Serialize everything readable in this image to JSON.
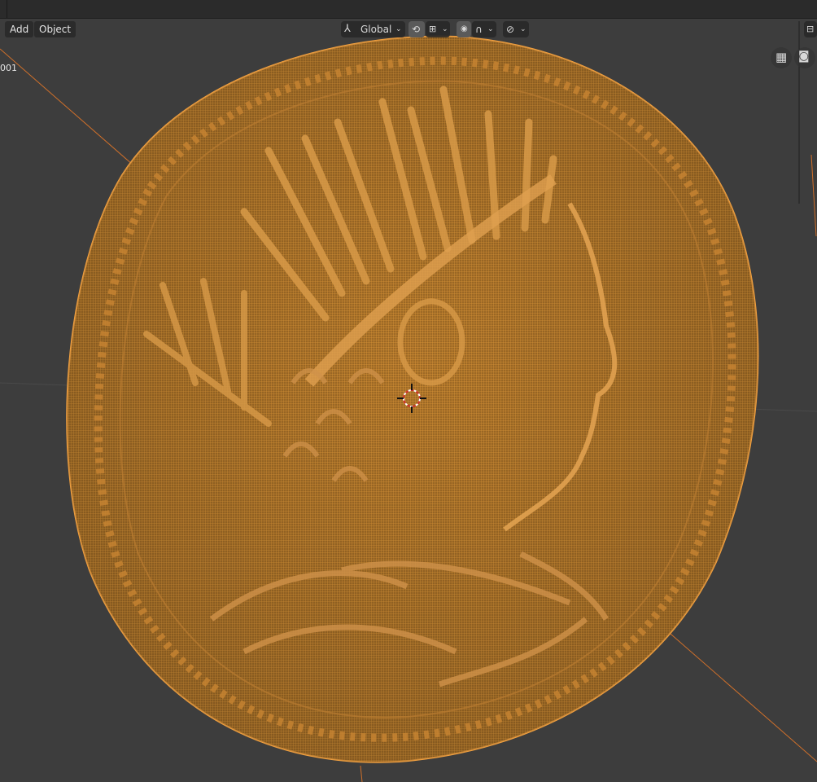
{
  "header": {
    "menus": [
      {
        "label": "Add"
      },
      {
        "label": "Object"
      }
    ],
    "transform_orientation": "Global",
    "pivot_icon": "transform-pivot-icon",
    "snap_icon": "magnet-snap-icon",
    "proportional_icon": "proportional-edit-icon",
    "falloff_icon": "falloff-curve-icon",
    "overlay_icon": "link-overlay-icon"
  },
  "viewport": {
    "object_label": "001",
    "nav_icons": [
      "grid-view-icon",
      "camera-view-icon"
    ],
    "selection_color": "#e8952e",
    "background_color": "#3d3d3d",
    "axis_color": "#e07830"
  }
}
